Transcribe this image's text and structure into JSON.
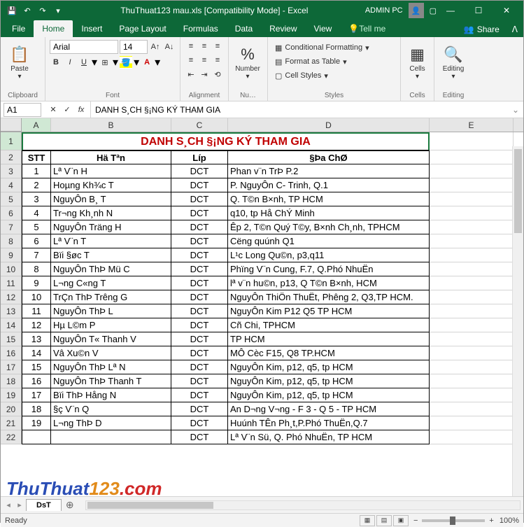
{
  "titlebar": {
    "filename": "ThuThuat123 mau.xls [Compatibility Mode] - Excel",
    "user": "ADMIN PC"
  },
  "tabs": {
    "file": "File",
    "home": "Home",
    "insert": "Insert",
    "pagelayout": "Page Layout",
    "formulas": "Formulas",
    "data": "Data",
    "review": "Review",
    "view": "View",
    "tellme": "Tell me",
    "share": "Share"
  },
  "ribbon": {
    "clipboard": {
      "label": "Clipboard",
      "paste": "Paste"
    },
    "font": {
      "label": "Font",
      "name": "Arial",
      "size": "14"
    },
    "alignment": {
      "label": "Alignment"
    },
    "number": {
      "label": "Nu…",
      "btn": "Number"
    },
    "styles": {
      "label": "Styles",
      "conditional": "Conditional Formatting",
      "table": "Format as Table",
      "cell": "Cell Styles"
    },
    "cells": {
      "label": "Cells",
      "btn": "Cells"
    },
    "editing": {
      "label": "Editing",
      "btn": "Editing"
    }
  },
  "formulabar": {
    "cellref": "A1",
    "formula": "DANH S¸CH §¡NG KÝ THAM GIA"
  },
  "columns": [
    "A",
    "B",
    "C",
    "D",
    "E"
  ],
  "title_text": "DANH S¸CH §¡NG KÝ THAM GIA",
  "headers": {
    "stt": "STT",
    "hoten": "Hä ­Tªn",
    "lop": "Líp",
    "diachi": "§Þa ChØ"
  },
  "rows": [
    {
      "n": "3",
      "stt": "1",
      "ht": "Lª V¨n H",
      "lop": "DCT",
      "dc": "Phan v¨n TrÞ P.2"
    },
    {
      "n": "4",
      "stt": "2",
      "ht": "Hoµng Kh¾c T",
      "lop": "DCT",
      "dc": "P. NguyÔn C- Trinh, Q.1"
    },
    {
      "n": "5",
      "stt": "3",
      "ht": "NguyÔn B¸ T",
      "lop": "DCT",
      "dc": "Q. T©n B×nh, TP HCM"
    },
    {
      "n": "6",
      "stt": "4",
      "ht": "Tr­¬ng Kh¸nh N",
      "lop": "DCT",
      "dc": "q10, tp Hå ChÝ Minh"
    },
    {
      "n": "7",
      "stt": "5",
      "ht": "NguyÔn Träng H",
      "lop": "DCT",
      "dc": "Êp 2, T©n Quý T©y, B×nh Ch¸nh, TPHCM"
    },
    {
      "n": "8",
      "stt": "6",
      "ht": "Lª V¨n T",
      "lop": "DCT",
      "dc": "Cëng quúnh Q1"
    },
    {
      "n": "9",
      "stt": "7",
      "ht": "Bïi §øc T",
      "lop": "DCT",
      "dc": "L¹c Long Qu©n, p3,q11"
    },
    {
      "n": "10",
      "stt": "8",
      "ht": "NguyÔn ThÞ Mü C",
      "lop": "DCT",
      "dc": "Phïng V¨n Cung, F.7, Q.Phó NhuËn"
    },
    {
      "n": "11",
      "stt": "9",
      "ht": "L­¬ng C«ng T",
      "lop": "DCT",
      "dc": "lª v¨n hu©n, p13, Q T©n B×nh, HCM"
    },
    {
      "n": "12",
      "stt": "10",
      "ht": "TrÇn ThÞ Tr­êng G",
      "lop": "DCT",
      "dc": "NguyÔn ThiÖn ThuËt, Ph­êng 2, Q3,TP HCM."
    },
    {
      "n": "13",
      "stt": "11",
      "ht": "NguyÔn ThÞ L",
      "lop": "DCT",
      "dc": "NguyÔn Kim P12 Q5 TP HCM"
    },
    {
      "n": "14",
      "stt": "12",
      "ht": "Hµ L©m P",
      "lop": "DCT",
      "dc": "Cñ Chi, TPHCM"
    },
    {
      "n": "15",
      "stt": "13",
      "ht": "NguyÔn T« Thanh V",
      "lop": "DCT",
      "dc": "TP HCM"
    },
    {
      "n": "16",
      "stt": "14",
      "ht": "Vâ Xu©n V",
      "lop": "DCT",
      "dc": "MÔ Cèc F15, Q8 TP.HCM"
    },
    {
      "n": "17",
      "stt": "15",
      "ht": "NguyÔn ThÞ Lª N",
      "lop": "DCT",
      "dc": "NguyÔn Kim, p12, q5, tp HCM"
    },
    {
      "n": "18",
      "stt": "16",
      "ht": "NguyÔn ThÞ Thanh T",
      "lop": "DCT",
      "dc": "NguyÔn Kim, p12, q5, tp HCM"
    },
    {
      "n": "19",
      "stt": "17",
      "ht": "Bïi ThÞ Hång N",
      "lop": "DCT",
      "dc": "NguyÔn Kim, p12, q5, tp HCM"
    },
    {
      "n": "20",
      "stt": "18",
      "ht": "§ç V¨n Q",
      "lop": "DCT",
      "dc": "An D­¬ng V­¬ng - F 3 - Q 5 - TP HCM"
    },
    {
      "n": "21",
      "stt": "19",
      "ht": " L­¬ng ThÞ D",
      "lop": "DCT",
      "dc": "Huúnh TÊn Ph¸t,P.Phó ThuËn,Q.7"
    },
    {
      "n": "22",
      "stt": "",
      "ht": "",
      "lop": "DCT",
      "dc": "Lª V¨n Sü, Q. Phó NhuËn, TP HCM"
    }
  ],
  "sheettab": "DsT",
  "status": {
    "ready": "Ready",
    "zoom": "100%"
  },
  "watermark": {
    "p1": "ThuThuat",
    "p2": "123",
    "p3": ".com"
  }
}
